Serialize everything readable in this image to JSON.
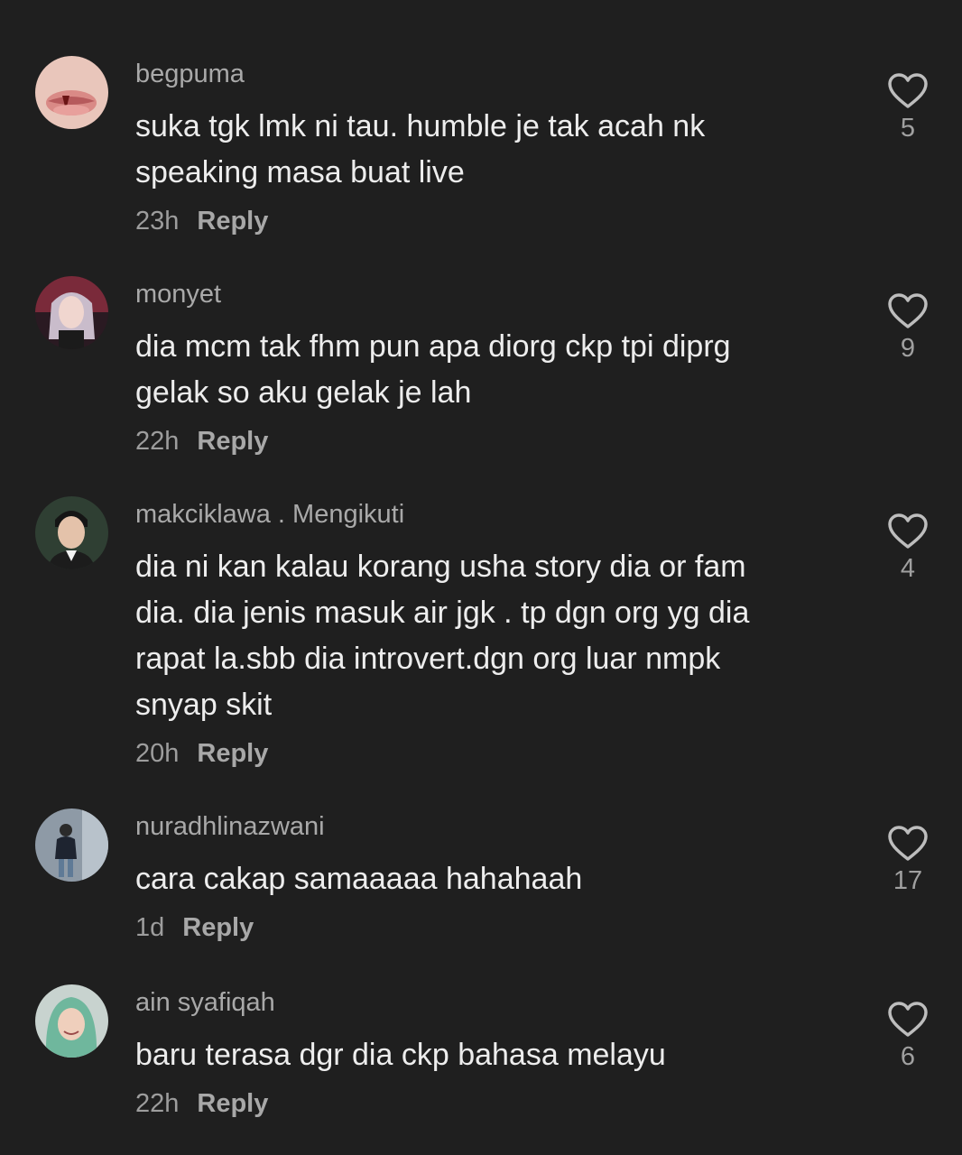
{
  "comments": [
    {
      "username": "begpuma",
      "text": "suka tgk lmk ni tau. humble je tak acah nk\nspeaking masa buat live",
      "time": "23h",
      "reply_label": "Reply",
      "likes": "5",
      "avatar_icon": "lips-avatar-icon"
    },
    {
      "username": "monyet",
      "text": "dia mcm tak fhm pun apa diorg ckp tpi diprg\ngelak so aku gelak je lah",
      "time": "22h",
      "reply_label": "Reply",
      "likes": "9",
      "avatar_icon": "woman-avatar-icon"
    },
    {
      "username": "makciklawa . Mengikuti",
      "text": "dia ni kan kalau korang usha story dia or fam\ndia. dia jenis masuk air jgk . tp dgn org yg dia\nrapat la.sbb dia introvert.dgn org luar nmpk\nsnyap skit",
      "time": "20h",
      "reply_label": "Reply",
      "likes": "4",
      "avatar_icon": "man-avatar-icon"
    },
    {
      "username": "nuradhlinazwani",
      "text": "cara cakap samaaaaa hahahaah",
      "time": "1d",
      "reply_label": "Reply",
      "likes": "17",
      "avatar_icon": "person-photo-avatar-icon"
    },
    {
      "username": "ain syafiqah",
      "text": "baru terasa dgr dia ckp bahasa melayu",
      "time": "22h",
      "reply_label": "Reply",
      "likes": "6",
      "avatar_icon": "hijab-avatar-icon"
    }
  ],
  "colors": {
    "background": "#1f1f1f",
    "text": "#ededed",
    "muted": "#a9a9a9"
  }
}
